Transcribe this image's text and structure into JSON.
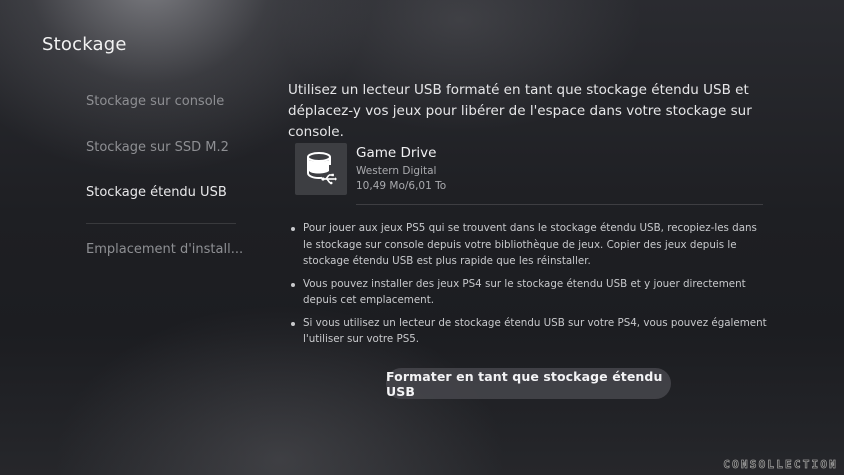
{
  "header": {
    "title": "Stockage"
  },
  "sidebar": {
    "items": [
      {
        "label": "Stockage sur console",
        "active": false
      },
      {
        "label": "Stockage sur SSD M.2",
        "active": false
      },
      {
        "label": "Stockage étendu USB",
        "active": true
      },
      {
        "label": "Emplacement d'install...",
        "active": false
      }
    ]
  },
  "main": {
    "intro": "Utilisez un lecteur USB formaté en tant que stockage étendu USB et déplacez-y vos jeux pour libérer de l'espace dans votre stockage sur console.",
    "drive": {
      "icon": "usb-drive-icon",
      "name": "Game Drive",
      "maker": "Western Digital",
      "usage": "10,49 Mo/6,01 To"
    },
    "bullets": [
      "Pour jouer aux jeux PS5 qui se trouvent dans le stockage étendu USB, recopiez-les dans le stockage sur console depuis votre bibliothèque de jeux. Copier des jeux depuis le stockage étendu USB est plus rapide que les réinstaller.",
      "Vous pouvez installer des jeux PS4 sur le stockage étendu USB et y jouer directement depuis cet emplacement.",
      "Si vous utilisez un lecteur de stockage étendu USB sur votre PS4, vous pouvez également l'utiliser sur votre PS5."
    ],
    "format_button_label": "Formater en tant que stockage étendu USB"
  },
  "watermark": "CONSOLLECTION",
  "colors": {
    "background": "#1c1d21",
    "text_primary": "#f0f0f2",
    "text_muted": "#8e8f93",
    "button_bg": "#46474c"
  }
}
